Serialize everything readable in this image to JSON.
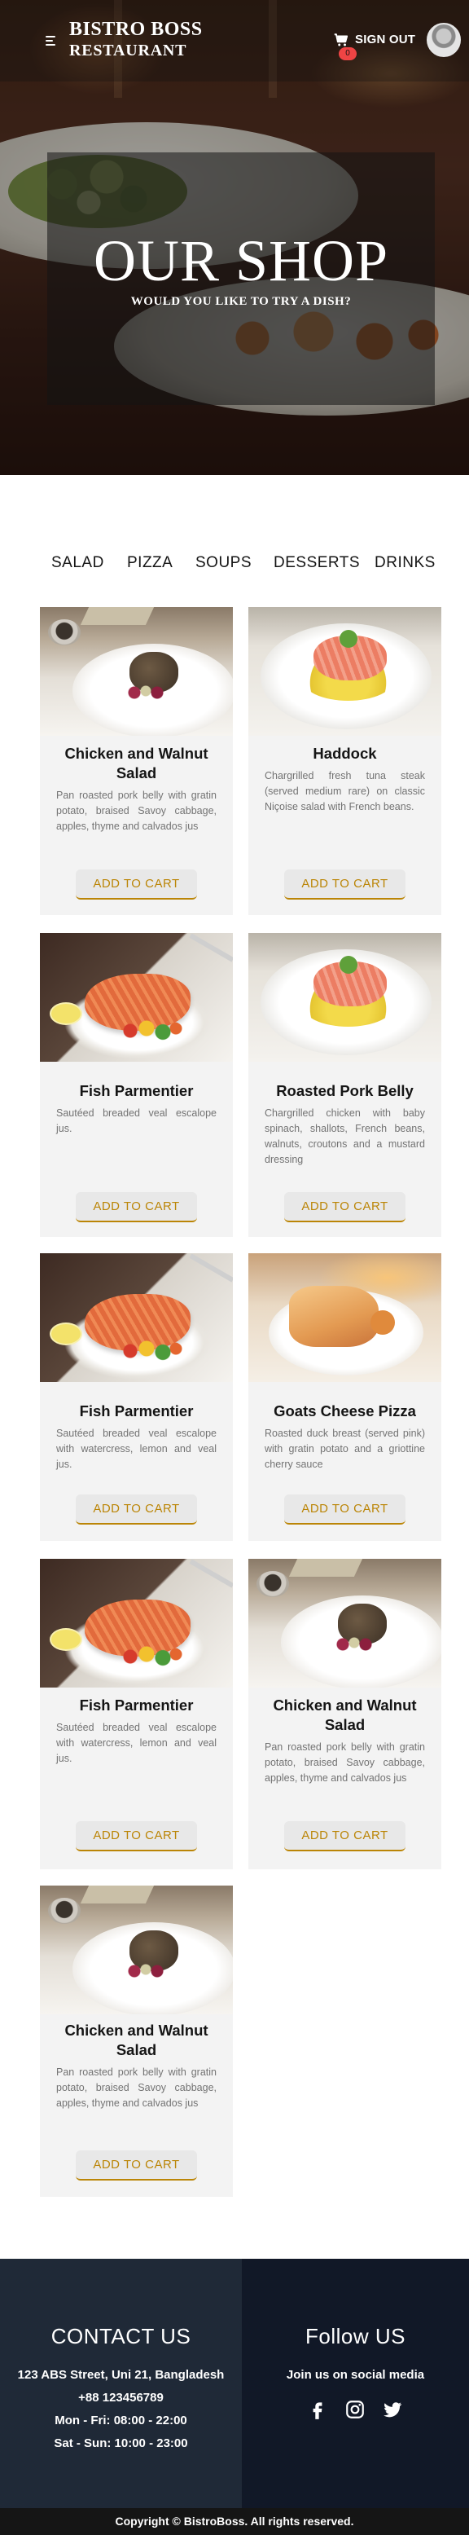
{
  "navbar": {
    "brand_line1": "BISTRO BOSS",
    "brand_line2": "RESTAURANT",
    "cart_count": "0",
    "signout_label": "SIGN OUT"
  },
  "hero": {
    "title": "OUR SHOP",
    "subtitle": "WOULD YOU LIKE TO TRY A DISH?"
  },
  "tabs": [
    "SALAD",
    "PIZZA",
    "SOUPS",
    "DESSERTS",
    "DRINKS"
  ],
  "cards": [
    {
      "title": "Chicken and Walnut Salad",
      "desc": "Pan roasted pork belly with gratin potato, braised Savoy cabbage, apples, thyme and calvados jus",
      "button": "ADD TO CART",
      "image": "walnut-salad"
    },
    {
      "title": "Haddock",
      "desc": "Chargrilled fresh tuna steak (served medium rare) on classic Niçoise salad with French beans.",
      "button": "ADD TO CART",
      "image": "haddock"
    },
    {
      "title": "Fish Parmentier",
      "desc": "Sautéed breaded veal escalope jus.",
      "button": "ADD TO CART",
      "image": "salmon"
    },
    {
      "title": "Roasted Pork Belly",
      "desc": "Chargrilled chicken with baby spinach, shallots, French beans, walnuts, croutons and a mustard dressing",
      "button": "ADD TO CART",
      "image": "haddock"
    },
    {
      "title": "Fish Parmentier",
      "desc": "Sautéed breaded veal escalope with watercress, lemon and veal jus.",
      "button": "ADD TO CART",
      "image": "salmon"
    },
    {
      "title": "Goats Cheese Pizza",
      "desc": "Roasted duck breast (served pink) with gratin potato and a griottine cherry sauce",
      "button": "ADD TO CART",
      "image": "pizza"
    },
    {
      "title": "Fish Parmentier",
      "desc": "Sautéed breaded veal escalope with watercress, lemon and veal jus.",
      "button": "ADD TO CART",
      "image": "salmon"
    },
    {
      "title": "Chicken and Walnut Salad",
      "desc": "Pan roasted pork belly with gratin potato, braised Savoy cabbage, apples, thyme and calvados jus",
      "button": "ADD TO CART",
      "image": "walnut-salad"
    },
    {
      "title": "Chicken and Walnut Salad",
      "desc": "Pan roasted pork belly with gratin potato, braised Savoy cabbage, apples, thyme and calvados jus",
      "button": "ADD TO CART",
      "image": "walnut-salad"
    }
  ],
  "footer": {
    "contact_title": "CONTACT US",
    "address": "123 ABS Street, Uni 21, Bangladesh",
    "phone": "+88 123456789",
    "hours_weekday": "Mon - Fri: 08:00 - 22:00",
    "hours_weekend": "Sat - Sun: 10:00 - 23:00",
    "follow_title": "Follow US",
    "follow_text": "Join us on social media",
    "social_icons": [
      "facebook-icon",
      "instagram-icon",
      "twitter-icon"
    ],
    "copyright": "Copyright © BistroBoss. All rights reserved."
  },
  "colors": {
    "accent": "#bb8506",
    "card_bg": "#f3f3f3",
    "footer_left": "#1f2937",
    "footer_right": "#111827",
    "badge": "#ef4444"
  }
}
